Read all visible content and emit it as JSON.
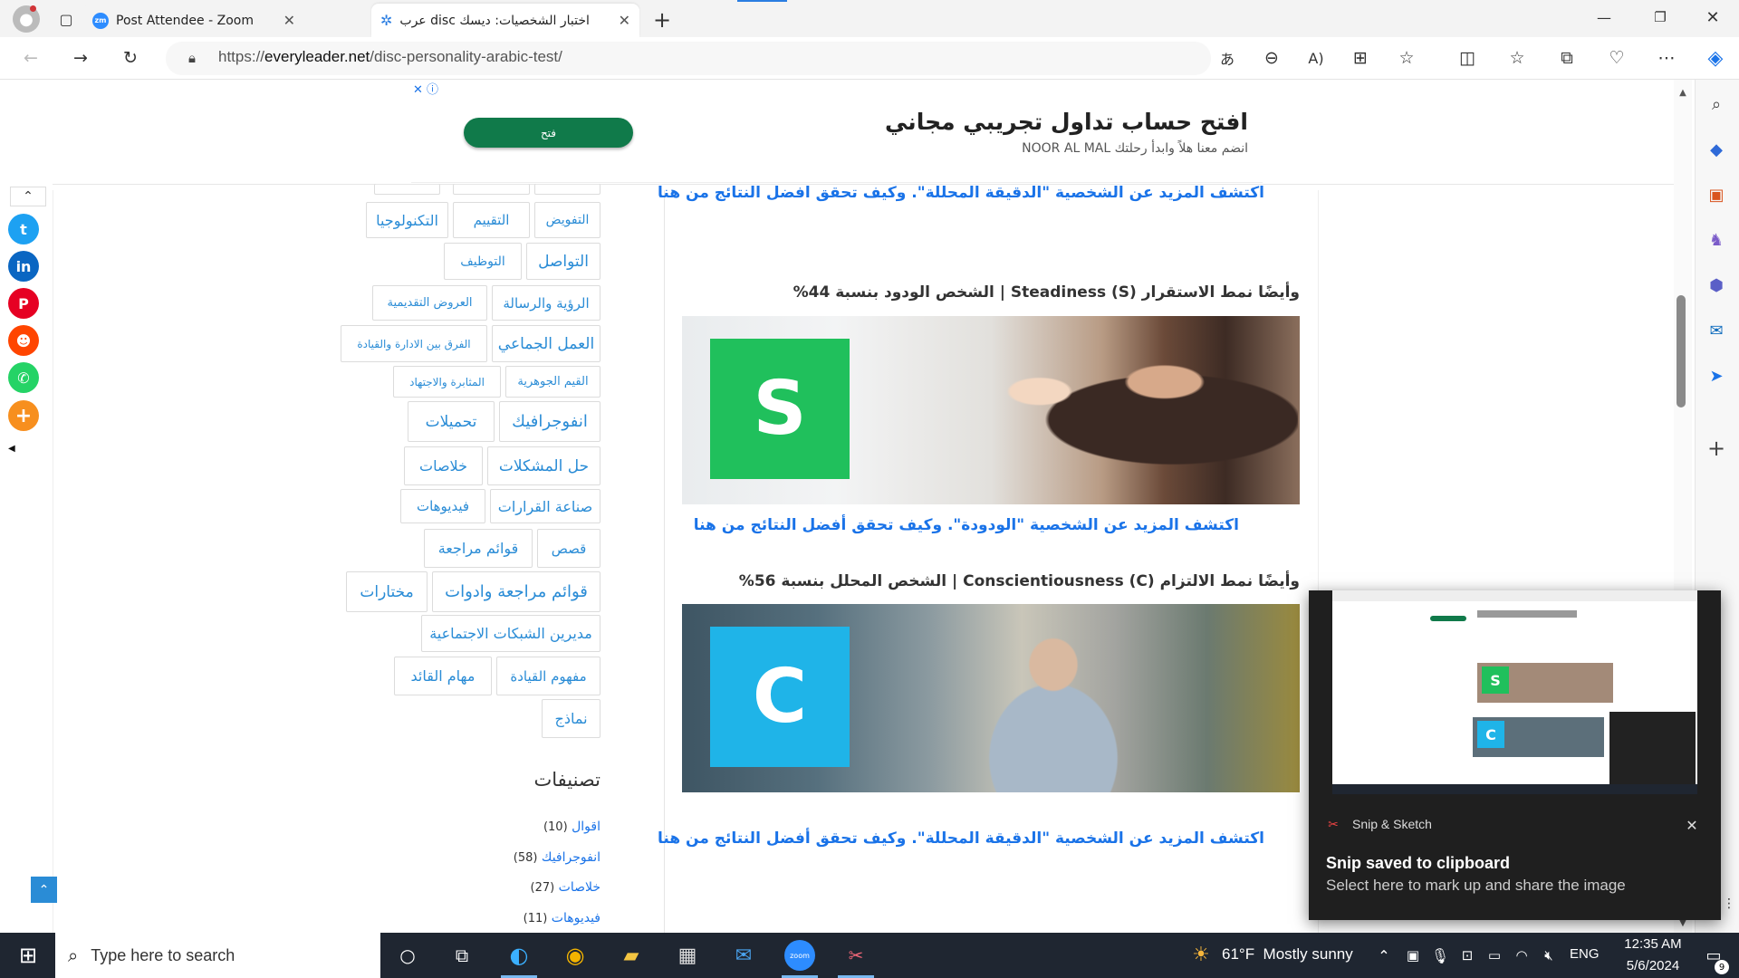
{
  "browser": {
    "tabs": [
      {
        "title": "Post Attendee - Zoom",
        "icon": "zoom-icon"
      },
      {
        "title": "اختبار الشخصيات: ديسك disc عرب",
        "icon": "settings-gear-icon"
      }
    ],
    "url_prefix": "https://",
    "url_domain": "everyleader.net",
    "url_path": "/disc-personality-arabic-test/"
  },
  "ad": {
    "title": "افتح حساب تداول تجريبي مجاني",
    "subtitle": "انضم معنا هلاً وابدأ رحلتك NOOR AL MAL",
    "button": "فتح",
    "close": "✕",
    "info": "ⓘ"
  },
  "tags": [
    "التفويض",
    "التقييم",
    "التكنولوجيا",
    "التواصل",
    "التوظيف",
    "الرؤية والرسالة",
    "العروض التقديمية",
    "العمل الجماعي",
    "الفرق بين الادارة والقيادة",
    "القيم الجوهرية",
    "المثابرة والاجتهاد",
    "انفوجرافيك",
    "تحميلات",
    "حل المشكلات",
    "خلاصات",
    "صناعة القرارات",
    "فيديوهات",
    "قصص",
    "قوائم مراجعة",
    "قوائم مراجعة وادوات",
    "مختارات",
    "مديرين الشبكات الاجتماعية",
    "مفهوم القيادة",
    "مهام القائد",
    "نماذج"
  ],
  "categories": {
    "heading": "تصنيفات",
    "items": [
      {
        "name": "اقوال",
        "count": "(10)"
      },
      {
        "name": "انفوجرافيك",
        "count": "(58)"
      },
      {
        "name": "خلاصات",
        "count": "(27)"
      },
      {
        "name": "فيديوهات",
        "count": "(11)"
      }
    ]
  },
  "content": {
    "link1": "اكتشف المزيد عن الشخصية \"الدقيقة المحللة\". وكيف تحقق افضل النتائج من هنا",
    "heading_s": "وأيضًا نمط الاستقرار Steadiness (S) | الشخص الودود بنسبة 44%",
    "letter_s": "S",
    "link2": "اكتشف المزيد عن الشخصية \"الودودة\". وكيف تحقق أفضل النتائج من هنا",
    "heading_c": "وأيضًا نمط الالتزام Conscientiousness (C) | الشخص المحلل بنسبة 56%",
    "letter_c": "C",
    "link3": "اكتشف المزيد عن الشخصية \"الدقيقة المحللة\". وكيف تحقق أفضل النتائج من هنا"
  },
  "toast": {
    "app": "Snip & Sketch",
    "title": "Snip saved to clipboard",
    "body": "Select here to mark up and share the image",
    "thumb_s": "S",
    "thumb_c": "C"
  },
  "taskbar": {
    "search_placeholder": "Type here to search",
    "weather": "61°F  Mostly sunny",
    "lang": "ENG",
    "time": "12:35 AM",
    "date": "5/6/2024",
    "notif_count": "9",
    "zoom_label": "zoom"
  },
  "colors": {
    "accent_link": "#1a73e8",
    "s_green": "#20c05c",
    "c_blue": "#1fb4e8",
    "ad_button": "#107a4a",
    "taskbar_bg": "#1f2631"
  }
}
